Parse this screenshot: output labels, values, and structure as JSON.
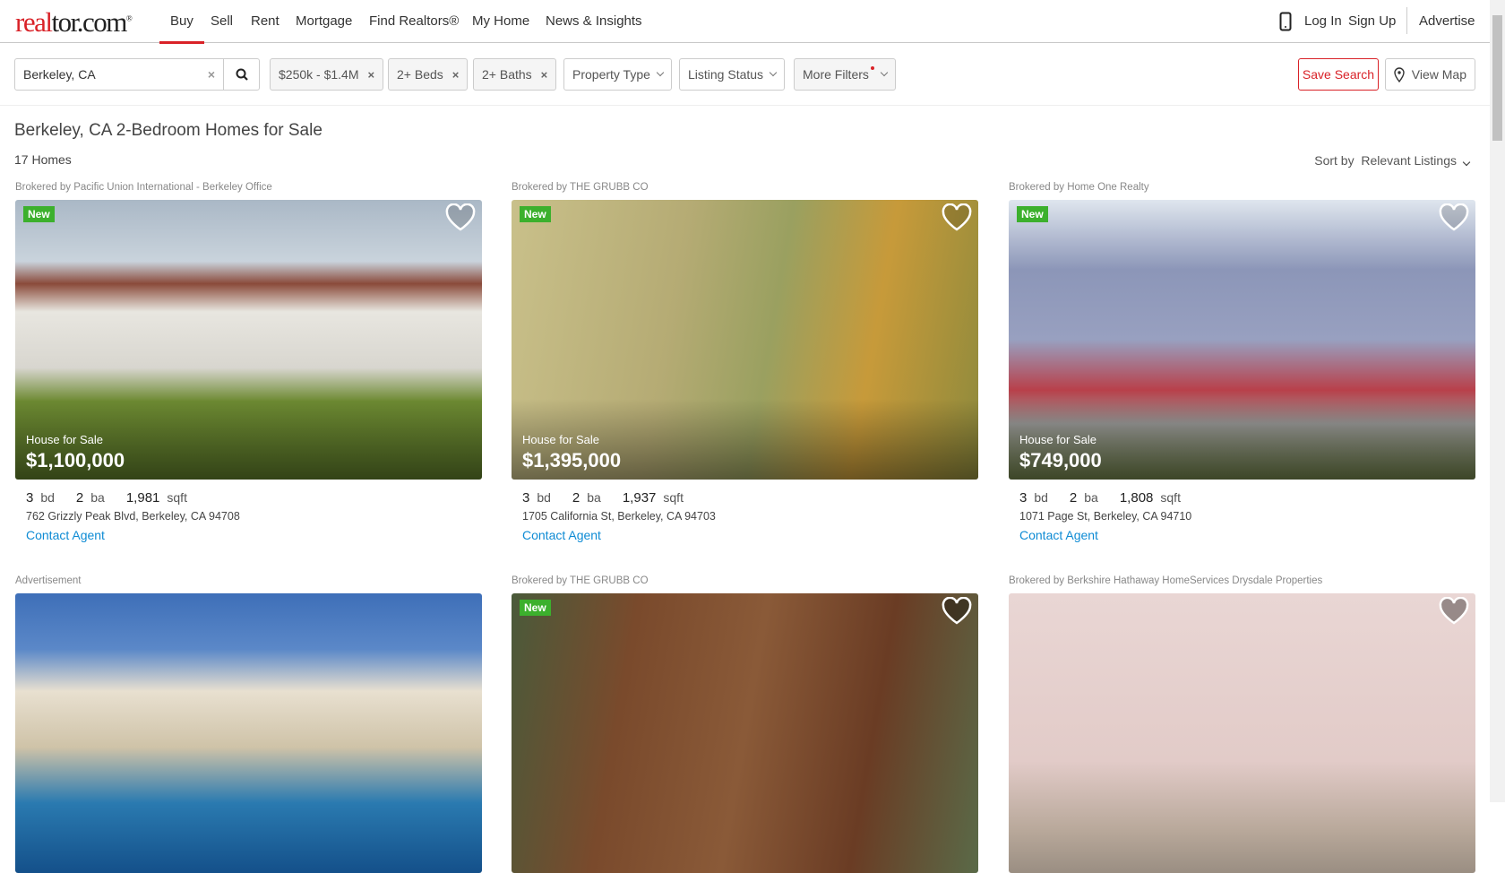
{
  "header": {
    "logo": "realtor.com",
    "nav": [
      "Buy",
      "Sell",
      "Rent",
      "Mortgage",
      "Find Realtors®",
      "My Home",
      "News & Insights"
    ],
    "login": "Log In",
    "signup": "Sign Up",
    "advertise": "Advertise"
  },
  "filters": {
    "search_value": "Berkeley, CA",
    "price": "$250k - $1.4M",
    "beds": "2+ Beds",
    "baths": "2+ Baths",
    "property_type": "Property Type",
    "listing_status": "Listing Status",
    "more": "More Filters",
    "save_search": "Save Search",
    "view_map": "View Map"
  },
  "results": {
    "title": "Berkeley, CA 2-Bedroom Homes for Sale",
    "count": "17 Homes",
    "sort_label": "Sort by",
    "sort_value": "Relevant Listings"
  },
  "listings": [
    {
      "broker": "Brokered by Pacific Union International - Berkeley Office",
      "badge": "New",
      "type": "House for Sale",
      "price": "$1,100,000",
      "beds": "3",
      "bd": "bd",
      "baths": "2",
      "ba": "ba",
      "sqft": "1,981",
      "sq": "sqft",
      "address": "762 Grizzly Peak Blvd, Berkeley, CA 94708",
      "contact": "Contact Agent"
    },
    {
      "broker": "Brokered by THE GRUBB CO",
      "badge": "New",
      "type": "House for Sale",
      "price": "$1,395,000",
      "beds": "3",
      "bd": "bd",
      "baths": "2",
      "ba": "ba",
      "sqft": "1,937",
      "sq": "sqft",
      "address": "1705 California St, Berkeley, CA 94703",
      "contact": "Contact Agent"
    },
    {
      "broker": "Brokered by Home One Realty",
      "badge": "New",
      "type": "House for Sale",
      "price": "$749,000",
      "beds": "3",
      "bd": "bd",
      "baths": "2",
      "ba": "ba",
      "sqft": "1,808",
      "sq": "sqft",
      "address": "1071 Page St, Berkeley, CA 94710",
      "contact": "Contact Agent"
    },
    {
      "broker": "Advertisement"
    },
    {
      "broker": "Brokered by THE GRUBB CO",
      "badge": "New"
    },
    {
      "broker": "Brokered by Berkshire Hathaway HomeServices Drysdale Properties"
    }
  ],
  "colors": {
    "brand": "#d92228",
    "new_badge": "#3cb02d",
    "link": "#0e8bd4"
  }
}
